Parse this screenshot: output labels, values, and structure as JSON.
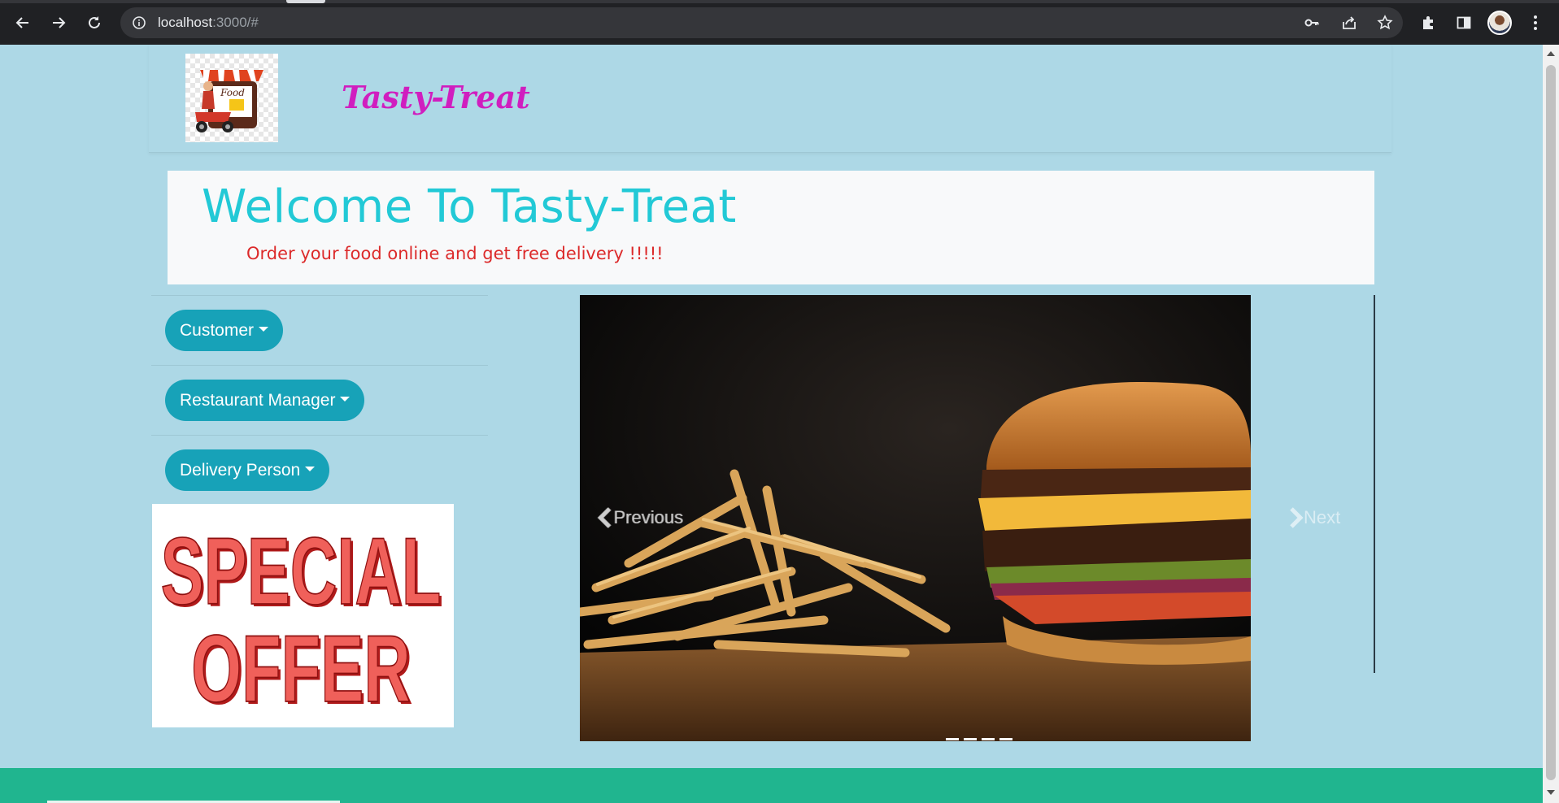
{
  "browser": {
    "url_host": "localhost",
    "url_rest": ":3000/#",
    "icons": [
      "back-arrow-icon",
      "forward-arrow-icon",
      "reload-icon",
      "info-icon",
      "key-icon",
      "share-icon",
      "star-icon",
      "puzzle-icon",
      "sidepanel-icon",
      "avatar",
      "kebab-menu-icon"
    ]
  },
  "header": {
    "brand": "Tasty-Treat",
    "logo_label": "Food Delivery"
  },
  "welcome": {
    "title": "Welcome To Tasty-Treat",
    "subtitle": "Order your food online and get free delivery !!!!!"
  },
  "sidebar": {
    "items": [
      {
        "label": "Customer"
      },
      {
        "label": "Restaurant Manager"
      },
      {
        "label": "Delivery Person"
      }
    ]
  },
  "promo": {
    "line1": "SPECIAL",
    "line2": "OFFER"
  },
  "carousel": {
    "prev_label": "Previous",
    "next_label": "Next",
    "indicator_count": 4,
    "active_index": 0
  },
  "colors": {
    "page_bg": "#add8e6",
    "brand": "#d01ebf",
    "welcome_title": "#22c9d6",
    "welcome_subtitle": "#dc2a2a",
    "button": "#17a2b8",
    "footer": "#20b58f"
  }
}
